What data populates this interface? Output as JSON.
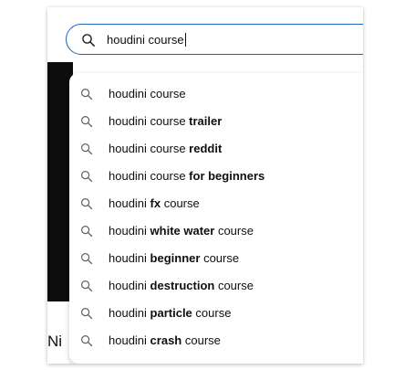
{
  "search": {
    "query": "houdini course"
  },
  "background": {
    "partial_title": "Ni"
  },
  "suggestions": [
    {
      "parts": [
        {
          "text": "houdini course",
          "bold": false
        }
      ]
    },
    {
      "parts": [
        {
          "text": "houdini course ",
          "bold": false
        },
        {
          "text": "trailer",
          "bold": true
        }
      ]
    },
    {
      "parts": [
        {
          "text": "houdini course ",
          "bold": false
        },
        {
          "text": "reddit",
          "bold": true
        }
      ]
    },
    {
      "parts": [
        {
          "text": "houdini course ",
          "bold": false
        },
        {
          "text": "for beginners",
          "bold": true
        }
      ]
    },
    {
      "parts": [
        {
          "text": "houdini ",
          "bold": false
        },
        {
          "text": "fx",
          "bold": true
        },
        {
          "text": " course",
          "bold": false
        }
      ]
    },
    {
      "parts": [
        {
          "text": "houdini ",
          "bold": false
        },
        {
          "text": "white water",
          "bold": true
        },
        {
          "text": " course",
          "bold": false
        }
      ]
    },
    {
      "parts": [
        {
          "text": "houdini ",
          "bold": false
        },
        {
          "text": "beginner",
          "bold": true
        },
        {
          "text": " course",
          "bold": false
        }
      ]
    },
    {
      "parts": [
        {
          "text": "houdini ",
          "bold": false
        },
        {
          "text": "destruction",
          "bold": true
        },
        {
          "text": " course",
          "bold": false
        }
      ]
    },
    {
      "parts": [
        {
          "text": "houdini ",
          "bold": false
        },
        {
          "text": "particle",
          "bold": true
        },
        {
          "text": " course",
          "bold": false
        }
      ]
    },
    {
      "parts": [
        {
          "text": "houdini ",
          "bold": false
        },
        {
          "text": "crash",
          "bold": true
        },
        {
          "text": " course",
          "bold": false
        }
      ]
    }
  ],
  "icons": {
    "search": "search-icon",
    "suggestion": "search-icon"
  },
  "colors": {
    "focus_border": "#1c62b9",
    "text": "#0f0f0f",
    "icon": "#606060"
  }
}
